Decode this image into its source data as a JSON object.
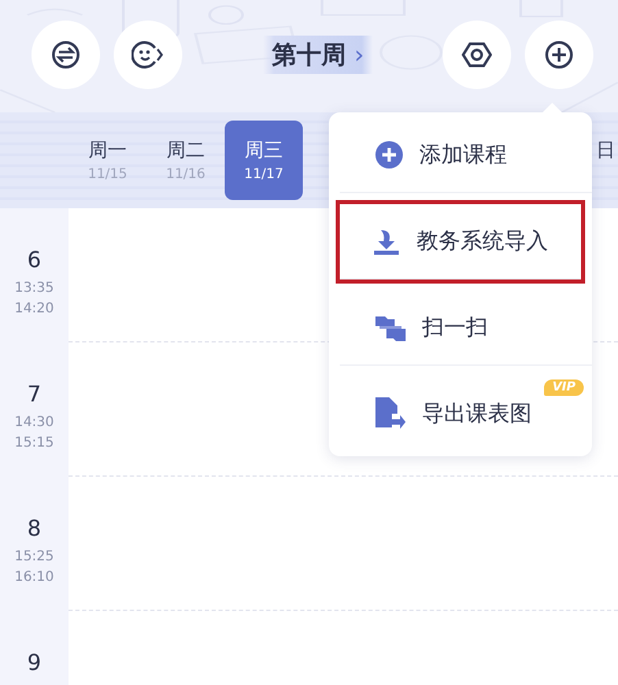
{
  "header": {
    "title": "第十周",
    "title_arrow": "›"
  },
  "days": [
    {
      "label": "周一",
      "date": "11/15",
      "selected": false
    },
    {
      "label": "周二",
      "date": "11/16",
      "selected": false
    },
    {
      "label": "周三",
      "date": "11/17",
      "selected": true
    }
  ],
  "days_partial": "日",
  "periods": [
    {
      "number": "6",
      "start": "13:35",
      "end": "14:20"
    },
    {
      "number": "7",
      "start": "14:30",
      "end": "15:15"
    },
    {
      "number": "8",
      "start": "15:25",
      "end": "16:10"
    },
    {
      "number": "9"
    }
  ],
  "menu": [
    {
      "kind": "add",
      "label": "添加课程",
      "highlighted": false
    },
    {
      "kind": "import",
      "label": "教务系统导入",
      "highlighted": true
    },
    {
      "kind": "scan",
      "label": "扫一扫",
      "highlighted": false
    },
    {
      "kind": "export",
      "label": "导出课表图",
      "highlighted": false,
      "badge": "VIP"
    }
  ]
}
